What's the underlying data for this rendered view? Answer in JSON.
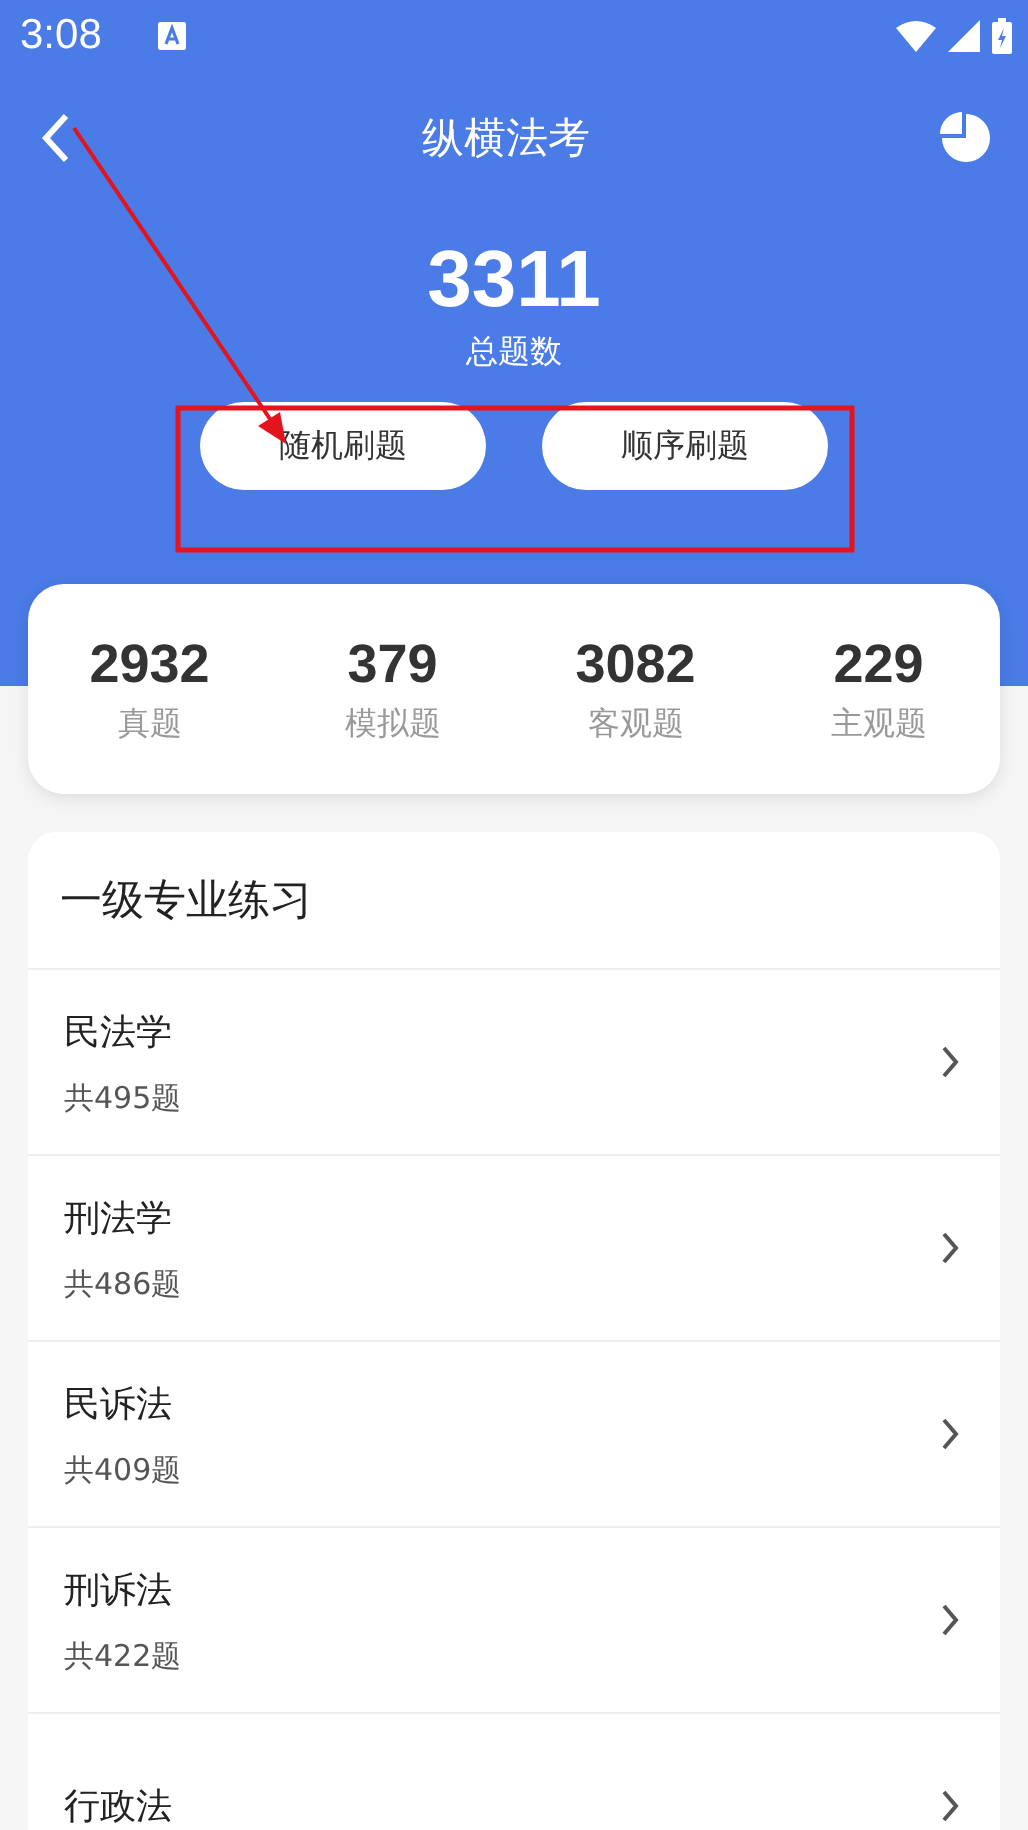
{
  "status_bar": {
    "time": "3:08"
  },
  "header": {
    "title": "纵横法考",
    "total": "3311",
    "total_label": "总题数"
  },
  "buttons": [
    "随机刷题",
    "顺序刷题"
  ],
  "stats": [
    {
      "value": "2932",
      "label": "真题"
    },
    {
      "value": "379",
      "label": "模拟题"
    },
    {
      "value": "3082",
      "label": "客观题"
    },
    {
      "value": "229",
      "label": "主观题"
    }
  ],
  "section": {
    "title": "一级专业练习",
    "items": [
      {
        "name": "民法学",
        "count": "共495题"
      },
      {
        "name": "刑法学",
        "count": "共486题"
      },
      {
        "name": "民诉法",
        "count": "共409题"
      },
      {
        "name": "刑诉法",
        "count": "共422题"
      },
      {
        "name": "行政法"
      }
    ]
  }
}
